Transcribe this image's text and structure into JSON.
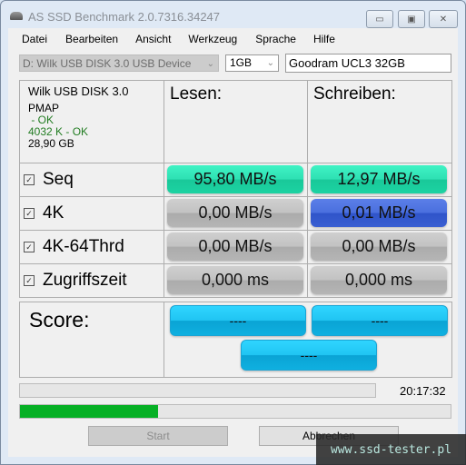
{
  "window": {
    "title": "AS SSD Benchmark 2.0.7316.34247",
    "controls": {
      "minimize": "▭",
      "maximize": "▣",
      "close": "✕"
    }
  },
  "menu": [
    "Datei",
    "Bearbeiten",
    "Ansicht",
    "Werkzeug",
    "Sprache",
    "Hilfe"
  ],
  "toolbar": {
    "drive": "D: Wilk USB DISK 3.0 USB Device",
    "size": "1GB",
    "name": "Goodram UCL3 32GB",
    "chevron": "⌄"
  },
  "device_info": {
    "model": "Wilk USB DISK 3.0",
    "driver": "PMAP",
    "driver_status": " - OK",
    "alignment": "4032 K - OK",
    "capacity": "28,90 GB"
  },
  "headers": {
    "read": "Lesen:",
    "write": "Schreiben:"
  },
  "check_mark": "✓",
  "tests": [
    {
      "label": "Seq",
      "checked": true,
      "read": "95,80 MB/s",
      "write": "12,97 MB/s",
      "read_color": "green",
      "write_color": "green"
    },
    {
      "label": "4K",
      "checked": true,
      "read": "0,00 MB/s",
      "write": "0,01 MB/s",
      "read_color": "gray",
      "write_color": "blue"
    },
    {
      "label": "4K-64Thrd",
      "checked": true,
      "read": "0,00 MB/s",
      "write": "0,00 MB/s",
      "read_color": "gray",
      "write_color": "gray"
    },
    {
      "label": "Zugriffszeit",
      "checked": true,
      "read": "0,000 ms",
      "write": "0,000 ms",
      "read_color": "gray",
      "write_color": "gray"
    }
  ],
  "score": {
    "label": "Score:",
    "read": "----",
    "write": "----",
    "total": "----"
  },
  "status": {
    "time": "20:17:32",
    "progress_percent": 32
  },
  "buttons": {
    "start": "Start",
    "cancel": "Abbrechen"
  },
  "watermark": "www.ssd-tester.pl",
  "colors": {
    "green": "#2ee0b3",
    "blue": "#3a5fd2",
    "gray": "#b5b5b5",
    "score": "#20c4f2",
    "progress": "#06b025"
  }
}
